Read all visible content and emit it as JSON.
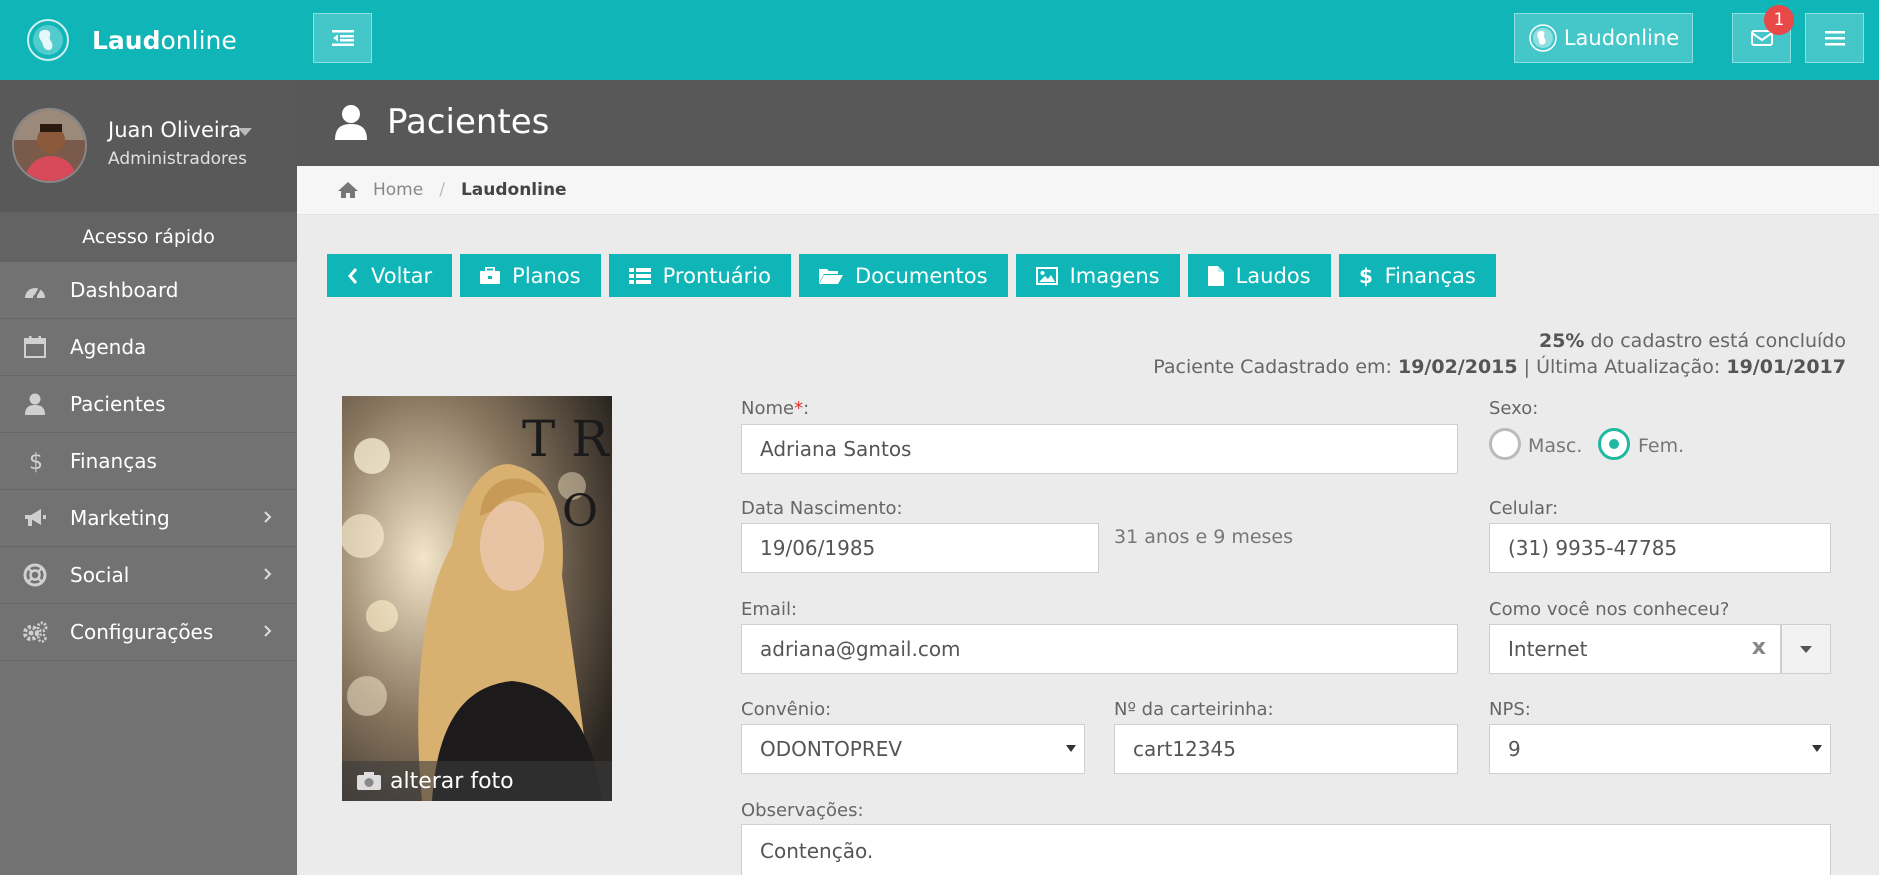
{
  "topbar": {
    "brand_bold": "Laud",
    "brand_light": "online",
    "right_brand_label": "Laudonline",
    "mail_badge": "1"
  },
  "sidebar": {
    "user_name": "Juan Oliveira",
    "user_role": "Administradores",
    "quick_access": "Acesso rápido",
    "items": [
      {
        "label": "Dashboard"
      },
      {
        "label": "Agenda"
      },
      {
        "label": "Pacientes"
      },
      {
        "label": "Finanças"
      },
      {
        "label": "Marketing"
      },
      {
        "label": "Social"
      },
      {
        "label": "Configurações"
      }
    ]
  },
  "page": {
    "title": "Pacientes",
    "breadcrumb": {
      "home": "Home",
      "separator": "/",
      "current": "Laudonline"
    }
  },
  "actions": [
    "Voltar",
    "Planos",
    "Prontuário",
    "Documentos",
    "Imagens",
    "Laudos",
    "Finanças"
  ],
  "status": {
    "percent": "25%",
    "percent_text": "do cadastro está concluído",
    "registered_label": "Paciente Cadastrado em:",
    "registered_date": "19/02/2015",
    "divider": "|",
    "updated_label": "Última Atualização:",
    "updated_date": "19/01/2017"
  },
  "photo": {
    "change_label": "alterar foto"
  },
  "form": {
    "nome_label": "Nome",
    "nome_req": "*",
    "nome_colon": ":",
    "nome_value": "Adriana Santos",
    "sexo_label": "Sexo:",
    "sexo_masc": "Masc.",
    "sexo_fem": "Fem.",
    "nascimento_label": "Data Nascimento:",
    "nascimento_value": "19/06/1985",
    "idade": "31 anos e 9 meses",
    "celular_label": "Celular:",
    "celular_value": "(31) 9935-47785",
    "email_label": "Email:",
    "email_value": "adriana@gmail.com",
    "conheceu_label": "Como você nos conheceu?",
    "conheceu_value": "Internet",
    "conheceu_clear": "x",
    "convenio_label": "Convênio:",
    "convenio_value": "ODONTOPREV",
    "carteirinha_label": "Nº da carteirinha:",
    "carteirinha_value": "cart12345",
    "nps_label": "NPS:",
    "nps_value": "9",
    "obs_label": "Observações:",
    "obs_value": "Contenção."
  }
}
